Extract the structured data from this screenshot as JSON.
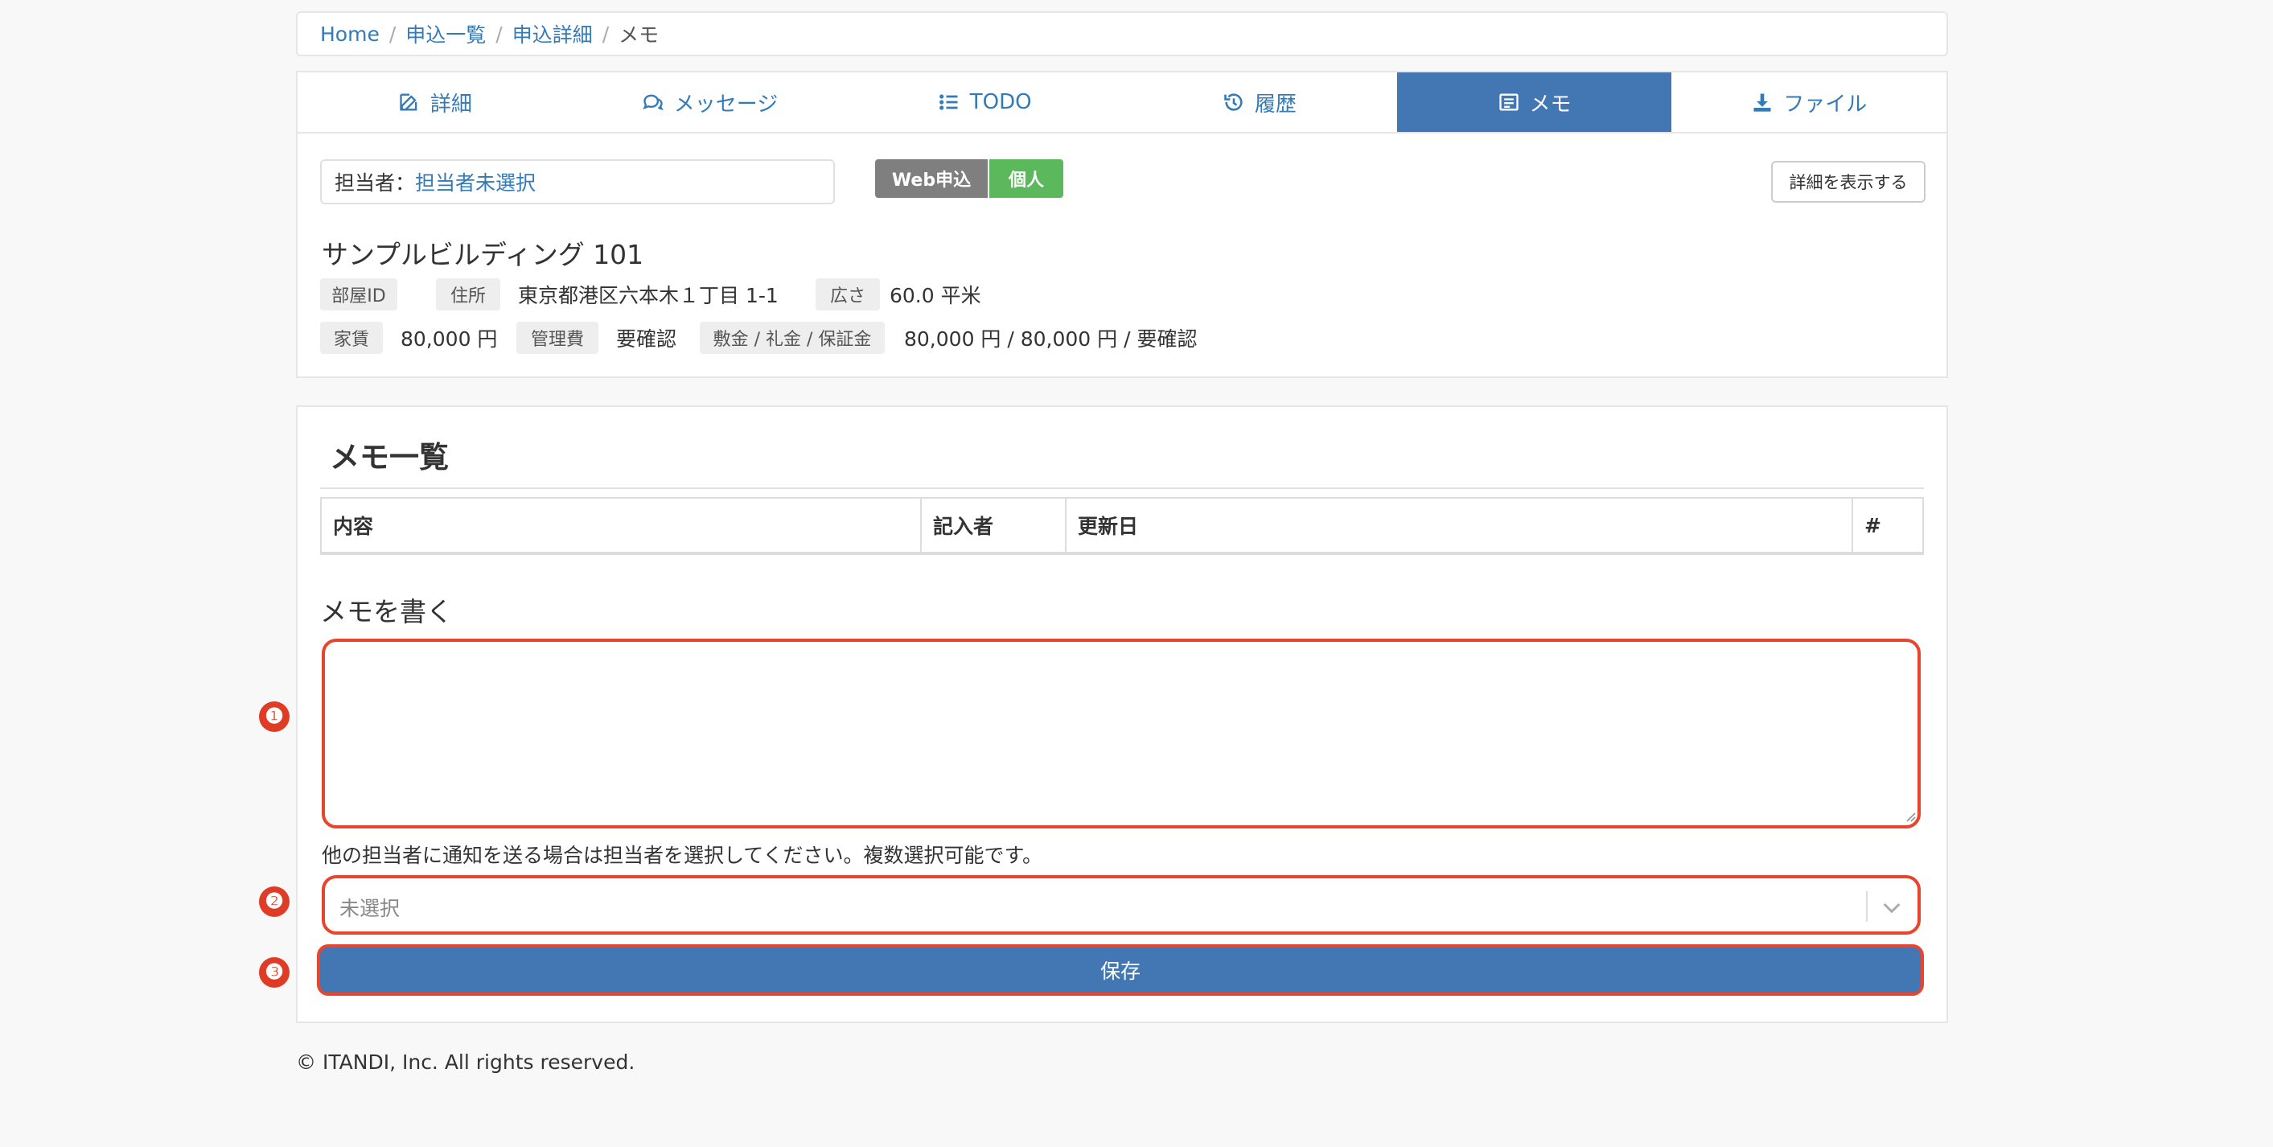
{
  "breadcrumb": {
    "items": [
      "Home",
      "申込一覧",
      "申込詳細"
    ],
    "current": "メモ",
    "separator": "/"
  },
  "tabs": [
    {
      "label": "詳細",
      "icon": "edit-icon"
    },
    {
      "label": "メッセージ",
      "icon": "chat-icon"
    },
    {
      "label": "TODO",
      "icon": "list-icon"
    },
    {
      "label": "履歴",
      "icon": "history-icon"
    },
    {
      "label": "メモ",
      "icon": "memo-icon",
      "active": true
    },
    {
      "label": "ファイル",
      "icon": "download-icon"
    }
  ],
  "assignee": {
    "label": "担当者：",
    "value": "担当者未選択"
  },
  "badges": {
    "web": "Web申込",
    "personal": "個人"
  },
  "detail_button": "詳細を表示する",
  "property": {
    "name": "サンプルビルディング 101",
    "room_id_label": "部屋ID",
    "room_id_value": "",
    "address_label": "住所",
    "address_value": "東京都港区六本木１丁目 1-1",
    "area_label": "広さ",
    "area_value": "60.0 平米",
    "rent_label": "家賃",
    "rent_value": "80,000 円",
    "mgmt_label": "管理費",
    "mgmt_value": "要確認",
    "deposit_label": "敷金 / 礼金 / 保証金",
    "deposit_value": "80,000 円 / 80,000 円 / 要確認"
  },
  "memo_list": {
    "title": "メモ一覧",
    "columns": [
      "内容",
      "記入者",
      "更新日",
      "#"
    ]
  },
  "memo_form": {
    "title": "メモを書く",
    "notify_text": "他の担当者に通知を送る場合は担当者を選択してください。複数選択可能です。",
    "select_placeholder": "未選択",
    "save_label": "保存"
  },
  "markers": [
    "❶",
    "❷",
    "❸"
  ],
  "colors": {
    "primary": "#4277b4",
    "highlight": "#e8452c",
    "success": "#5cb85c",
    "badge_gray": "#7f7f7f"
  },
  "footer": "© ITANDI, Inc. All rights reserved."
}
